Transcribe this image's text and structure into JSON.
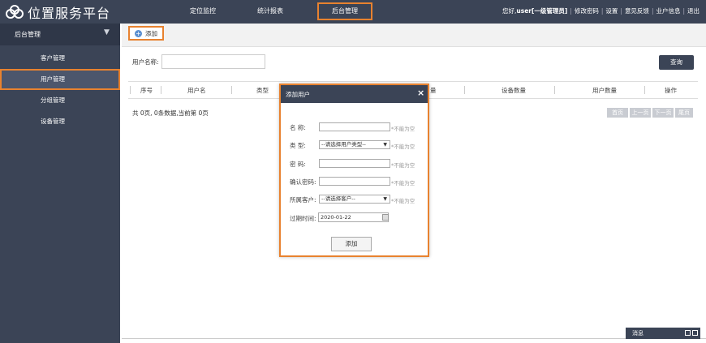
{
  "app": {
    "title": "位置服务平台",
    "logo_icon": "cloud-logo-icon"
  },
  "nav": [
    {
      "label": "定位监控"
    },
    {
      "label": "统计报表"
    },
    {
      "label": "后台管理",
      "active": true
    }
  ],
  "user_bar": {
    "greeting": "您好,",
    "user": "user",
    "role": "[一级管理员]",
    "links": [
      "修改密码",
      "设置",
      "意见反馈",
      "业户信息",
      "退出"
    ]
  },
  "sidebar": {
    "header": "后台管理",
    "items": [
      "客户管理",
      "用户管理",
      "分组管理",
      "设备管理"
    ],
    "active_index": 1
  },
  "toolbar": {
    "add_label": "添加"
  },
  "search": {
    "label": "用户名称:",
    "value": "",
    "button": "查询"
  },
  "table": {
    "columns": [
      "序号",
      "用户名",
      "类型",
      "量",
      "设备数量",
      "用户数量",
      "操作"
    ],
    "rows": []
  },
  "pagination": {
    "info": "共 0页, 0条数据,当前第 0页",
    "buttons": [
      "首页",
      "上一页",
      "下一页",
      "尾页"
    ]
  },
  "modal": {
    "title": "添加用户",
    "close": "×",
    "required_hint": "*不能为空",
    "fields": {
      "name": {
        "label": "名 称:",
        "value": ""
      },
      "type": {
        "label": "类 型:",
        "value": "--请选择用户类型--"
      },
      "password": {
        "label": "密 码:",
        "value": ""
      },
      "confirm": {
        "label": "确认密码:",
        "value": ""
      },
      "customer": {
        "label": "所属客户:",
        "value": "--请选择客户--"
      },
      "expire": {
        "label": "过期时间:",
        "value": "2020-01-22"
      }
    },
    "submit": "添加"
  },
  "message_bar": {
    "label": "消息"
  },
  "colors": {
    "header_bg": "#3b4456",
    "highlight": "#e8822f",
    "accent_blue": "#5a8fd0"
  }
}
